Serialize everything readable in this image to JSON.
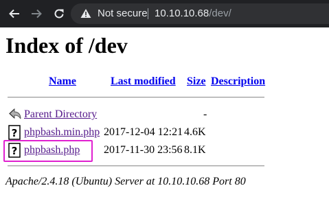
{
  "browser": {
    "security_label": "Not secure",
    "url_host": "10.10.10.68",
    "url_path": "/dev/",
    "colors": {
      "toolbar": "#202124",
      "omnibox": "#303134"
    }
  },
  "page": {
    "title": "Index of /dev",
    "columns": {
      "name": "Name",
      "last_modified": "Last modified",
      "size": "Size",
      "description": "Description"
    },
    "rows": [
      {
        "icon": "back-arrow-icon",
        "name": "Parent Directory",
        "last_modified": "",
        "size": "-"
      },
      {
        "icon": "unknown-file-icon",
        "name": "phpbash.min.php",
        "last_modified": "2017-12-04 12:21",
        "size": "4.6K"
      },
      {
        "icon": "unknown-file-icon",
        "name": "phpbash.php",
        "last_modified": "2017-11-30 23:56",
        "size": "8.1K"
      }
    ],
    "address": "Apache/2.4.18 (Ubuntu) Server at 10.10.10.68 Port 80",
    "highlight_color": "#e020d0"
  }
}
